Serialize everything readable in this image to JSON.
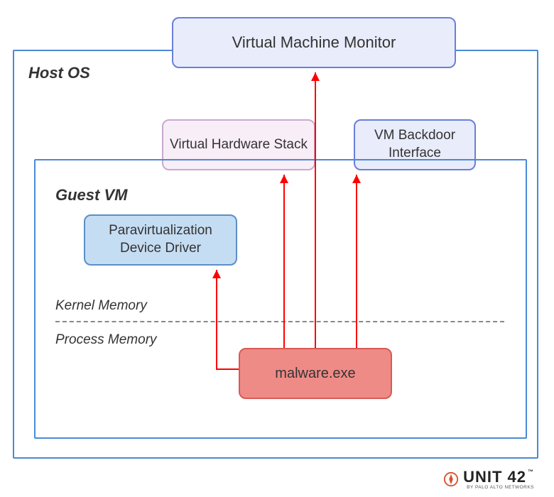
{
  "diagram": {
    "host_os_label": "Host OS",
    "guest_vm_label": "Guest VM",
    "kernel_memory_label": "Kernel Memory",
    "process_memory_label": "Process Memory",
    "vmm_label": "Virtual Machine Monitor",
    "vhs_label": "Virtual Hardware Stack",
    "vmbi_label": "VM Backdoor Interface",
    "pvdd_label": "Paravirtualization Device Driver",
    "malware_label": "malware.exe"
  },
  "colors": {
    "accent": "#4b89d6",
    "arrow": "#ff0000",
    "vmm_fill": "#e9ecfb",
    "vhs_fill": "#f8eef8",
    "vmbi_fill": "#e9ecfb",
    "pvdd_fill": "#c5ddf3",
    "malware_fill": "#ef8b87"
  },
  "branding": {
    "name": "UNIT 42",
    "tagline": "BY PALO ALTO NETWORKS",
    "mark_color": "#d94f2b"
  }
}
